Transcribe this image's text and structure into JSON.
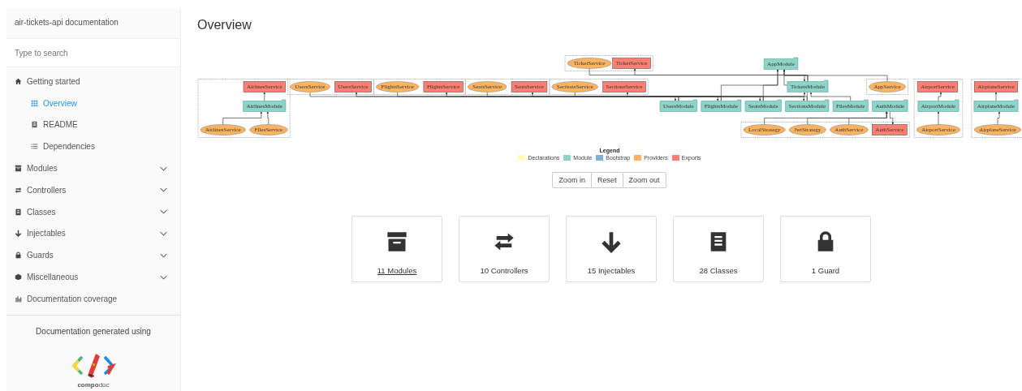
{
  "sidebar": {
    "title": "air-tickets-api documentation",
    "search": {
      "placeholder": "Type to search"
    },
    "menu": [
      {
        "label": "Getting started",
        "expanded": true,
        "children": [
          {
            "label": "Overview",
            "selected": true
          },
          {
            "label": "README",
            "selected": false
          },
          {
            "label": "Dependencies",
            "selected": false
          }
        ]
      },
      {
        "label": "Modules",
        "expanded": false
      },
      {
        "label": "Controllers",
        "expanded": false
      },
      {
        "label": "Classes",
        "expanded": false
      },
      {
        "label": "Injectables",
        "expanded": false
      },
      {
        "label": "Guards",
        "expanded": false
      },
      {
        "label": "Miscellaneous",
        "expanded": false
      },
      {
        "label": "Documentation coverage"
      }
    ],
    "footer": {
      "text": "Documentation generated using",
      "logo": "**compo**doc"
    }
  },
  "page": {
    "title": "Overview",
    "graph": {
      "nodes": [
        {
          "label": "TicketService",
          "kind": "provider"
        },
        {
          "label": "TicketService",
          "kind": "export"
        },
        {
          "label": "AppModule",
          "kind": "module"
        },
        {
          "label": "AirlinesService",
          "kind": "export"
        },
        {
          "label": "UsersService",
          "kind": "provider"
        },
        {
          "label": "UsersService",
          "kind": "export"
        },
        {
          "label": "FlightsService",
          "kind": "provider"
        },
        {
          "label": "FlightsService",
          "kind": "export"
        },
        {
          "label": "SeatsService",
          "kind": "provider"
        },
        {
          "label": "SeatsService",
          "kind": "export"
        },
        {
          "label": "SectionsService",
          "kind": "provider"
        },
        {
          "label": "SectionsService",
          "kind": "export"
        },
        {
          "label": "TicketsModule",
          "kind": "module"
        },
        {
          "label": "AppService",
          "kind": "provider"
        },
        {
          "label": "AirportService",
          "kind": "export"
        },
        {
          "label": "AirplaneService",
          "kind": "export"
        },
        {
          "label": "AirlinesModule",
          "kind": "module"
        },
        {
          "label": "UsersModule",
          "kind": "module"
        },
        {
          "label": "FlightsModule",
          "kind": "module"
        },
        {
          "label": "SeatsModule",
          "kind": "module"
        },
        {
          "label": "SectionsModule",
          "kind": "module"
        },
        {
          "label": "FilesModule",
          "kind": "module"
        },
        {
          "label": "AuthModule",
          "kind": "module"
        },
        {
          "label": "AirportModule",
          "kind": "module"
        },
        {
          "label": "AirplaneModule",
          "kind": "module"
        },
        {
          "label": "AirlinesService",
          "kind": "provider"
        },
        {
          "label": "FilesService",
          "kind": "provider"
        },
        {
          "label": "LocalStrategy",
          "kind": "provider"
        },
        {
          "label": "JwtStrategy",
          "kind": "provider"
        },
        {
          "label": "AuthService",
          "kind": "provider"
        },
        {
          "label": "AuthService",
          "kind": "export"
        },
        {
          "label": "AirportService",
          "kind": "provider"
        },
        {
          "label": "AirplaneService",
          "kind": "provider"
        }
      ],
      "legend": {
        "title": "Legend",
        "items": [
          {
            "label": "Declarations",
            "color": "#ffffb3"
          },
          {
            "label": "Module",
            "color": "#8dd3c7"
          },
          {
            "label": "Bootstrap",
            "color": "#80b1d3"
          },
          {
            "label": "Providers",
            "color": "#fdb462"
          },
          {
            "label": "Exports",
            "color": "#fb8072"
          }
        ]
      },
      "buttons": [
        "Zoom in",
        "Reset",
        "Zoom out"
      ]
    },
    "cards": [
      {
        "label": "11 Modules",
        "link": true
      },
      {
        "label": "10 Controllers",
        "link": false
      },
      {
        "label": "15 Injectables",
        "link": false
      },
      {
        "label": "28 Classes",
        "link": false
      },
      {
        "label": "1 Guard",
        "link": false
      }
    ]
  }
}
